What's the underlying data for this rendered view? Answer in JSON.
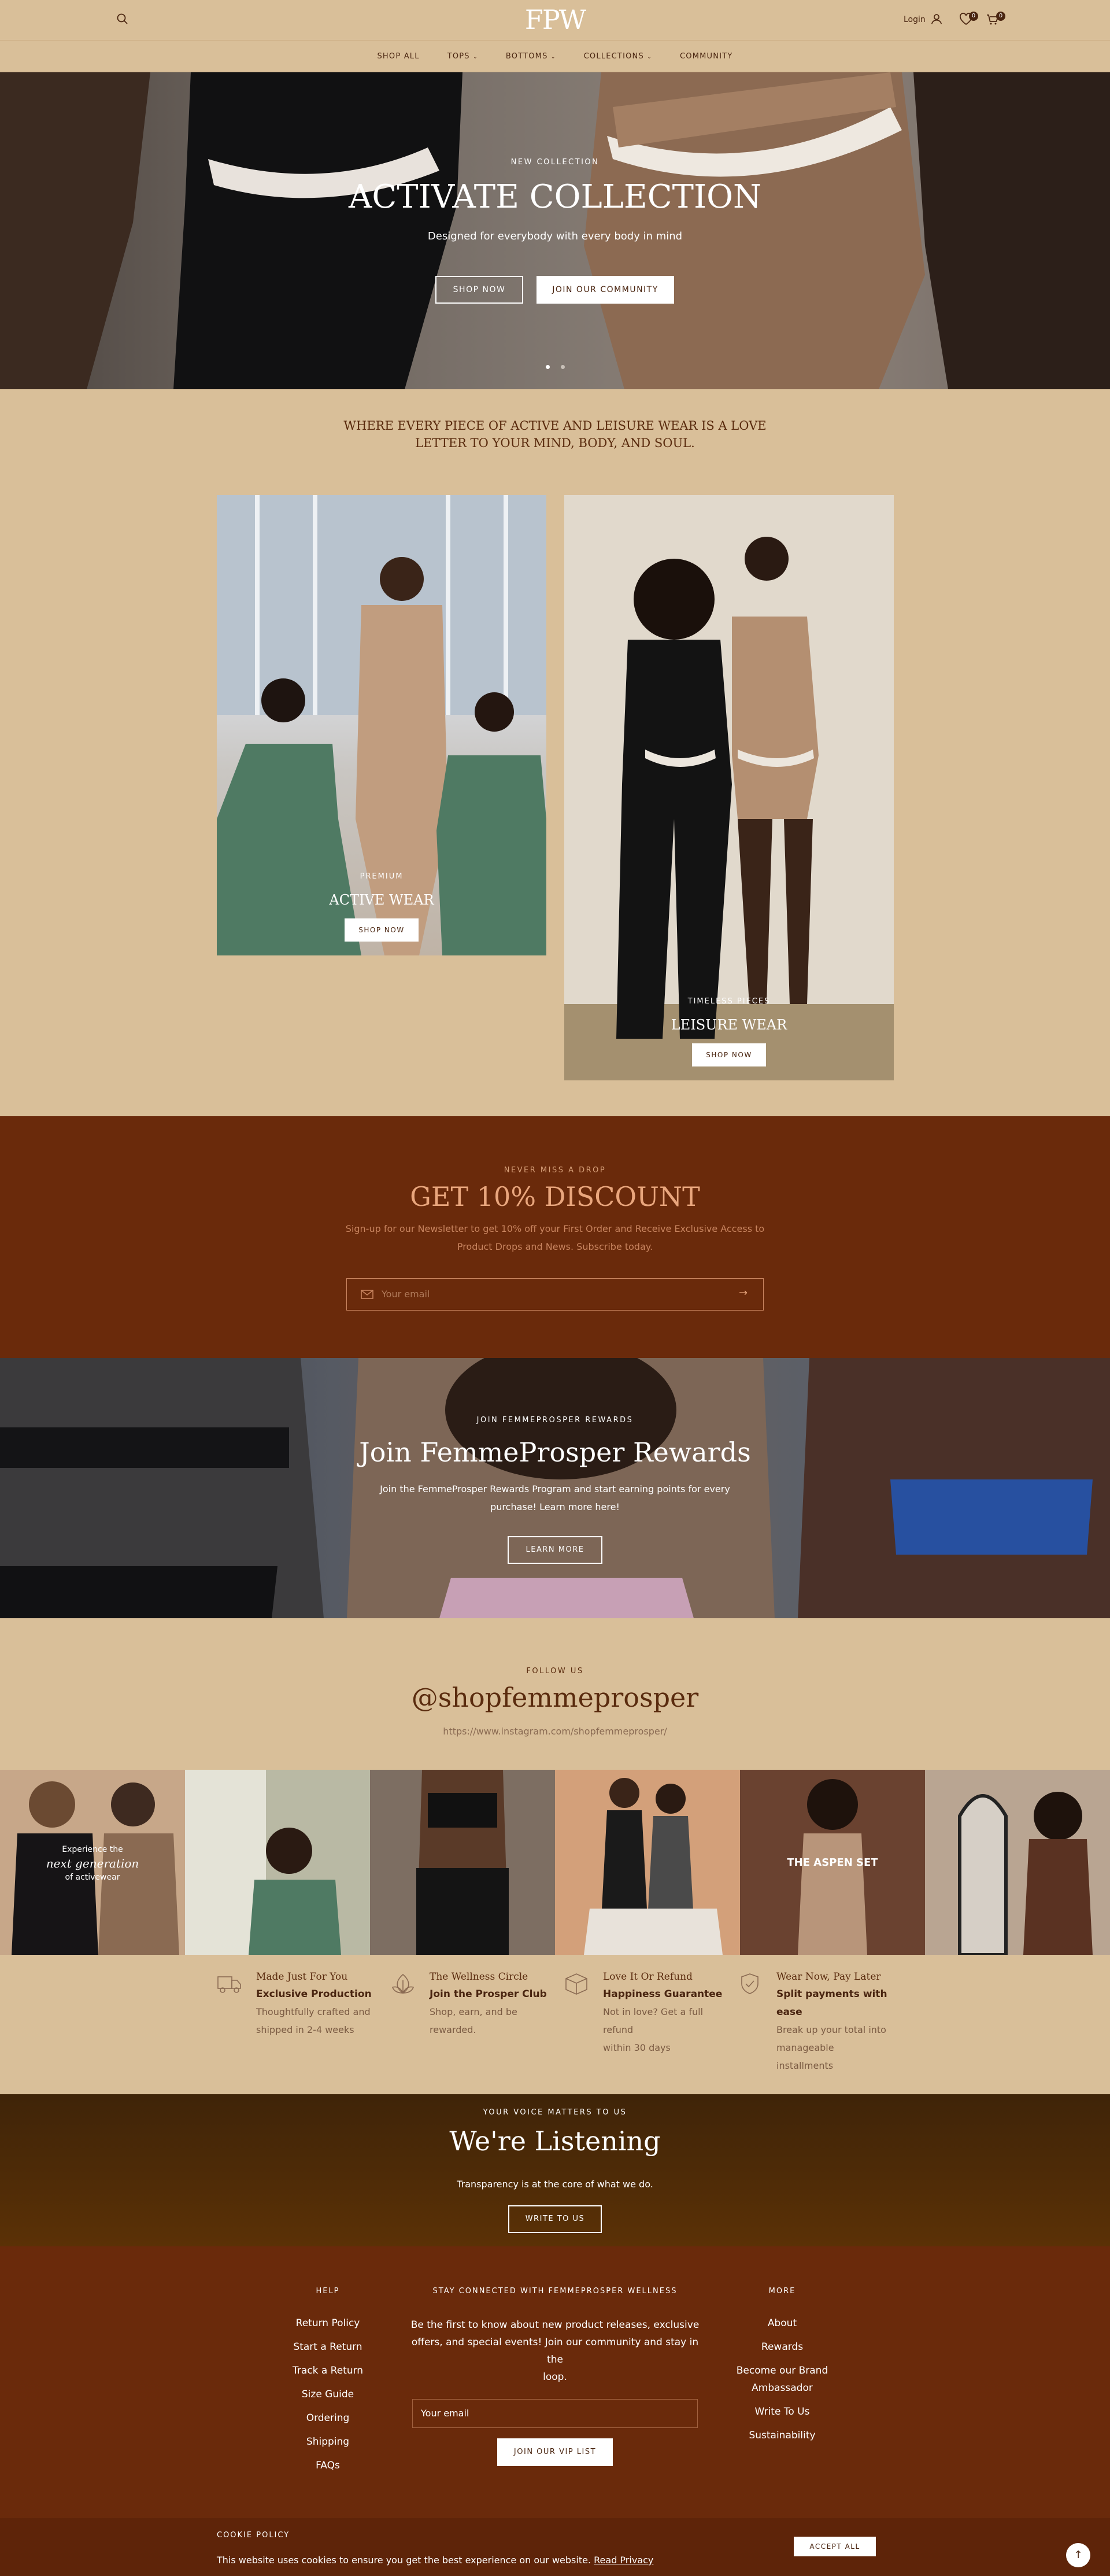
{
  "header": {
    "logo": "FPW",
    "login_label": "Login",
    "wishlist_count": "0",
    "cart_count": "0",
    "nav": [
      "SHOP ALL",
      "TOPS",
      "BOTTOMS",
      "COLLECTIONS",
      "COMMUNITY"
    ]
  },
  "hero": {
    "kicker": "NEW COLLECTION",
    "title": "ACTIVATE COLLECTION",
    "subtitle": "Designed for everybody with every body in mind",
    "shop_now": "SHOP NOW",
    "join_community": "JOIN OUR COMMUNITY"
  },
  "intro": {
    "line1": "WHERE EVERY PIECE OF ACTIVE AND LEISURE WEAR IS A LOVE",
    "line2": "LETTER TO YOUR MIND, BODY, AND SOUL."
  },
  "cards": [
    {
      "kicker": "PREMIUM",
      "title": "ACTIVE WEAR",
      "button": "SHOP NOW"
    },
    {
      "kicker": "TIMELESS PIECES",
      "title": "LEISURE WEAR",
      "button": "SHOP NOW"
    }
  ],
  "newsletter": {
    "kicker": "NEVER MISS A DROP",
    "title": "GET 10% DISCOUNT",
    "text1": "Sign-up for our Newsletter to get 10% off your First Order and Receive Exclusive Access to",
    "text2": "Product Drops and News. Subscribe today.",
    "placeholder": "Your email"
  },
  "rewards": {
    "kicker": "JOIN FEMMEPROSPER REWARDS",
    "title": "Join FemmeProsper Rewards",
    "text1": "Join the FemmeProsper Rewards Program and start earning points for every",
    "text2": "purchase! Learn more here!",
    "button": "LEARN MORE"
  },
  "instagram": {
    "kicker": "FOLLOW US",
    "handle": "@shopfemmeprosper",
    "url": "https://www.instagram.com/shopfemmeprosper/",
    "tile1_line1": "Experience the",
    "tile1_line2": "next generation",
    "tile1_line3": "of activewear",
    "tile5_text": "THE ASPEN SET"
  },
  "features": [
    {
      "icon": "truck-icon",
      "title": "Made Just For You",
      "bold": "Exclusive Production",
      "lines": [
        "Thoughtfully crafted and",
        "shipped in 2-4 weeks"
      ]
    },
    {
      "icon": "leaf-icon",
      "title": "The Wellness Circle",
      "bold": "Join the Prosper Club",
      "lines": [
        "Shop, earn, and be",
        "rewarded."
      ]
    },
    {
      "icon": "box-icon",
      "title": "Love It Or Refund",
      "bold": "Happiness Guarantee",
      "lines": [
        "Not in love? Get a full",
        "refund",
        "within 30 days"
      ]
    },
    {
      "icon": "shield-check-icon",
      "title": "Wear Now, Pay Later",
      "bold": "Split payments with",
      "bold2": "ease",
      "lines": [
        "Break up your total into",
        "manageable",
        "installments"
      ]
    }
  ],
  "listening": {
    "kicker": "YOUR VOICE MATTERS TO US",
    "title": "We're Listening",
    "text": "Transparency is at the core of what we do.",
    "button": "WRITE TO US"
  },
  "footer": {
    "help_heading": "HELP",
    "help_links": [
      "Return Policy",
      "Start a Return",
      "Track a Return",
      "Size Guide",
      "Ordering",
      "Shipping",
      "FAQs"
    ],
    "connect_heading": "STAY CONNECTED WITH FEMMEPROSPER WELLNESS",
    "connect_text1": "Be the first to know about new product releases, exclusive",
    "connect_text2": "offers, and special events! Join our community and stay in the",
    "connect_text3": "loop.",
    "email_placeholder": "Your email",
    "vip_button": "JOIN OUR VIP LIST",
    "more_heading": "MORE",
    "more_links": [
      "About",
      "Rewards",
      "Become our Brand",
      "Ambassador",
      "Write To Us",
      "Sustainability"
    ]
  },
  "cookie": {
    "heading": "COOKIE POLICY",
    "text": "This website uses cookies to ensure you get the best experience on our website.",
    "link": "Read Privacy",
    "accept": "ACCEPT ALL"
  },
  "colors": {
    "sand": "#d9bf99",
    "rust": "#6a2a0b",
    "brown": "#5a2b0e"
  }
}
